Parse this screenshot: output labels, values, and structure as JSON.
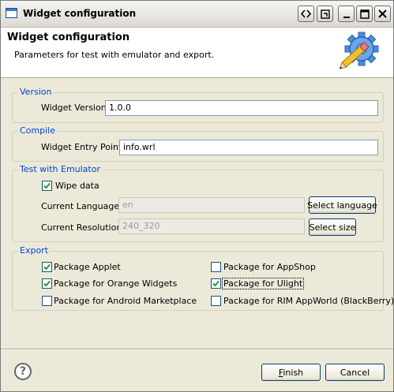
{
  "window": {
    "title": "Widget configuration",
    "controls": [
      "restore-icon",
      "fit-icon",
      "minimize-icon",
      "maximize-icon",
      "close-icon"
    ]
  },
  "header": {
    "title": "Widget configuration",
    "subtitle": "Parameters for test with emulator and export.",
    "icon": "gear-pencil-icon"
  },
  "version": {
    "group_title": "Version",
    "label": "Widget Version:",
    "value": "1.0.0"
  },
  "compile": {
    "group_title": "Compile",
    "label": "Widget Entry Point:",
    "value": "info.wrl"
  },
  "emulator": {
    "group_title": "Test with Emulator",
    "wipe_label": "Wipe data",
    "wipe_checked": true,
    "language_label": "Current Language:",
    "language_value": "en",
    "language_button": "Select language",
    "resolution_label": "Current Resolution:",
    "resolution_value": "240_320",
    "resolution_button": "Select size"
  },
  "export": {
    "group_title": "Export",
    "options": [
      {
        "label": "Package Applet",
        "checked": true
      },
      {
        "label": "Package for Orange Widgets",
        "checked": true
      },
      {
        "label": "Package for Android Marketplace",
        "checked": false
      },
      {
        "label": "Package for AppShop",
        "checked": false
      },
      {
        "label": "Package for Ulight",
        "checked": true
      },
      {
        "label": "Package for RIM AppWorld (BlackBerry)",
        "checked": false
      }
    ]
  },
  "footer": {
    "help_icon": "help-icon",
    "finish_mnemonic": "F",
    "finish_rest": "inish",
    "cancel_label": "Cancel"
  },
  "colors": {
    "group_title": "#0046d5",
    "dialog_bg": "#ece9d8",
    "checkmark": "#21a121"
  }
}
